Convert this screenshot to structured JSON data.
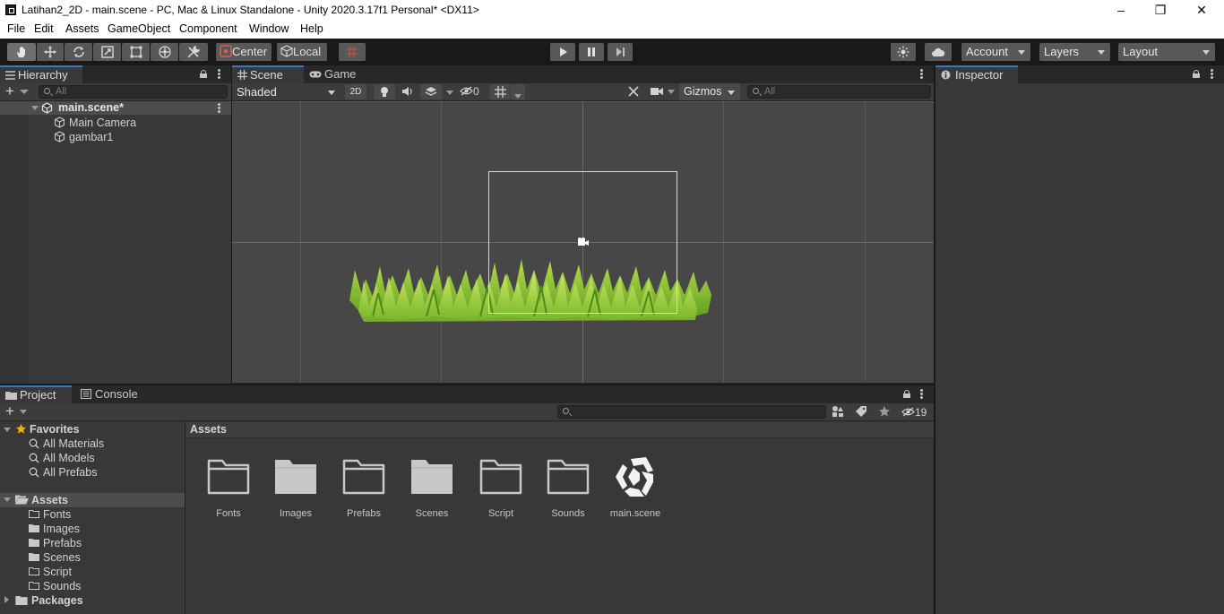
{
  "window": {
    "title": "Latihan2_2D - main.scene - PC, Mac & Linux Standalone - Unity 2020.3.17f1 Personal* <DX11>",
    "minimize": "–",
    "maximize": "❐",
    "close": "✕"
  },
  "menu": [
    "File",
    "Edit",
    "Assets",
    "GameObject",
    "Component",
    "Window",
    "Help"
  ],
  "toolbar": {
    "pivot_label": "Center",
    "space_label": "Local",
    "account_label": "Account",
    "layers_label": "Layers",
    "layout_label": "Layout"
  },
  "hierarchy": {
    "tab_label": "Hierarchy",
    "search_placeholder": "All",
    "scene_name": "main.scene*",
    "objects": [
      "Main Camera",
      "gambar1"
    ]
  },
  "scene": {
    "tabs": [
      "Scene",
      "Game"
    ],
    "shading_mode": "Shaded",
    "mode_2d_label": "2D",
    "hidden_count": "0",
    "gizmos_label": "Gizmos",
    "search_placeholder": "All"
  },
  "inspector": {
    "tab_label": "Inspector"
  },
  "project": {
    "tabs": [
      "Project",
      "Console"
    ],
    "hidden_count": "19",
    "favorites_label": "Favorites",
    "favorites": [
      "All Materials",
      "All Models",
      "All Prefabs"
    ],
    "assets_label": "Assets",
    "asset_folders": [
      "Fonts",
      "Images",
      "Prefabs",
      "Scenes",
      "Script",
      "Sounds"
    ],
    "packages_label": "Packages",
    "breadcrumb": "Assets",
    "grid_items": [
      {
        "label": "Fonts",
        "icon": "folder-empty-icon"
      },
      {
        "label": "Images",
        "icon": "folder-filled-icon"
      },
      {
        "label": "Prefabs",
        "icon": "folder-empty-icon"
      },
      {
        "label": "Scenes",
        "icon": "folder-filled-icon"
      },
      {
        "label": "Script",
        "icon": "folder-empty-icon"
      },
      {
        "label": "Sounds",
        "icon": "folder-empty-icon"
      },
      {
        "label": "main.scene",
        "icon": "unity-scene-icon"
      }
    ]
  },
  "colors": {
    "accent": "#3a79bb",
    "panel_bg": "#383838",
    "scene_bg": "#474747",
    "grass": "#8cc63f"
  }
}
